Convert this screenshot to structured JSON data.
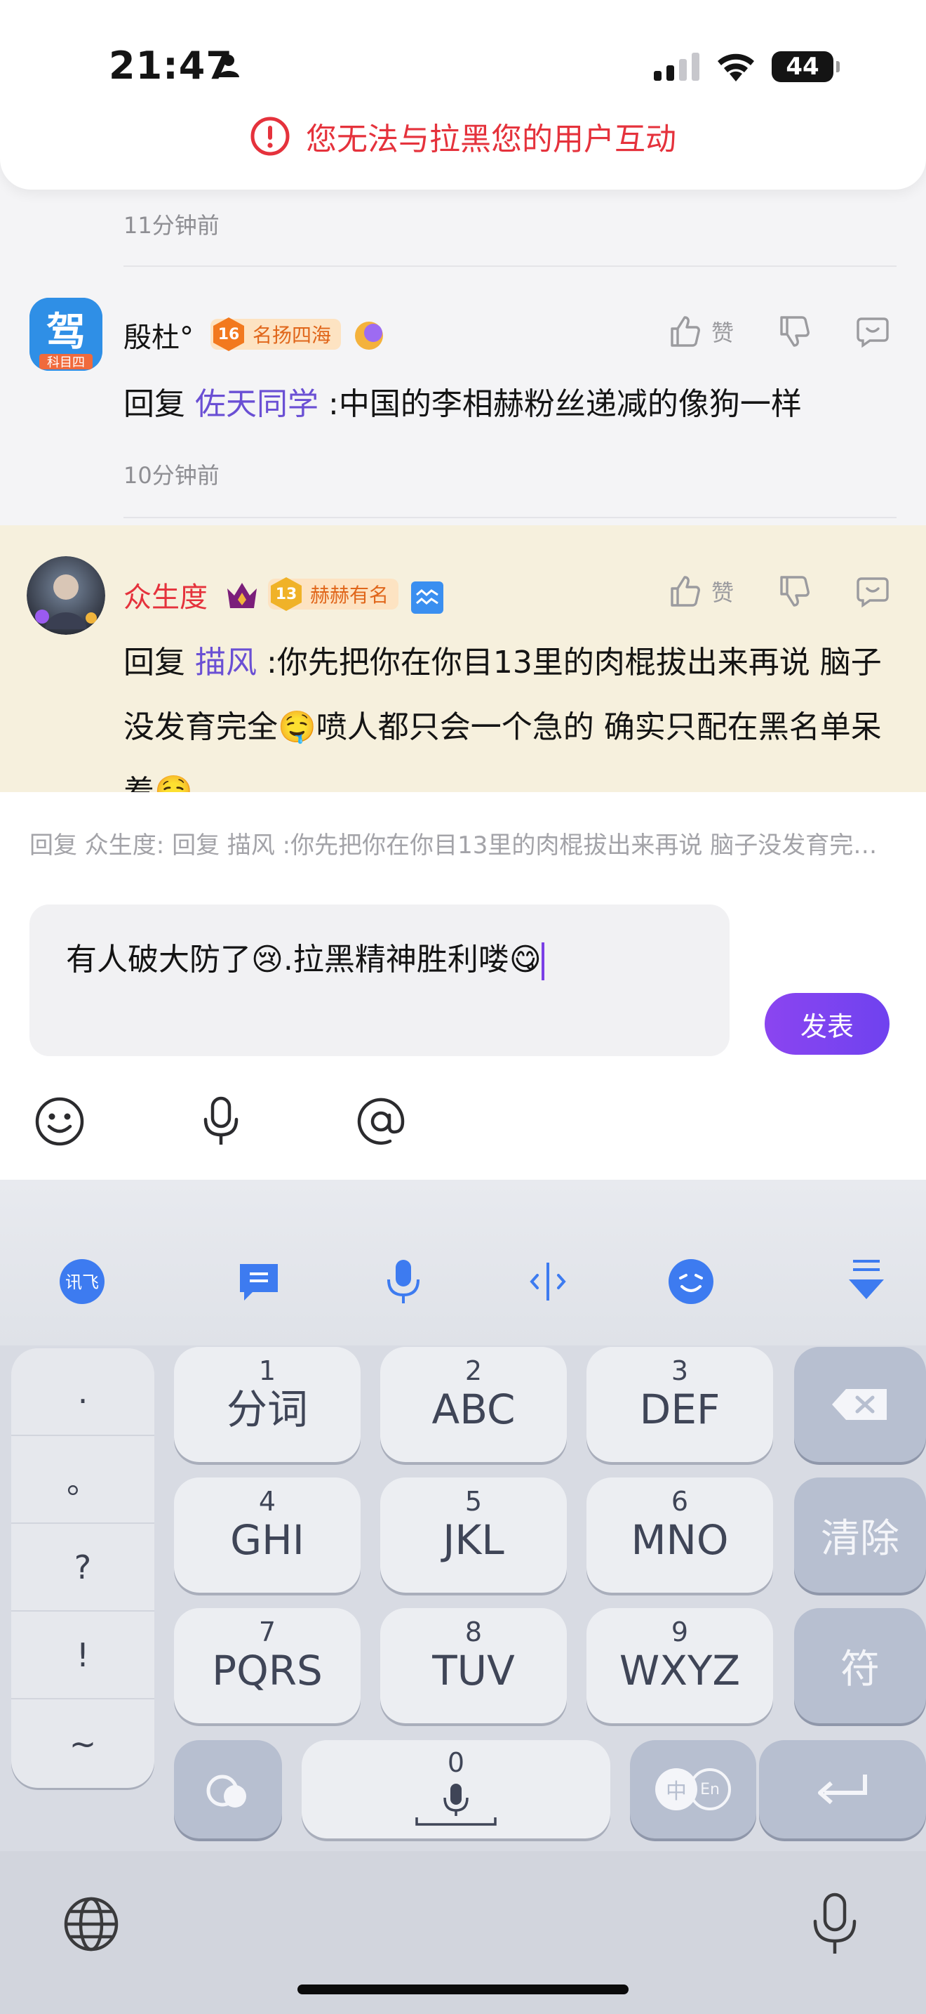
{
  "status_bar": {
    "time": "21:47",
    "battery": "44"
  },
  "banner": {
    "text": "您无法与拉黑您的用户互动"
  },
  "feed": {
    "prev_time": "11分钟前",
    "comments": [
      {
        "username": "殷杜°",
        "badge_level": "16",
        "badge_text": "名扬四海",
        "reply_prefix": "回复",
        "mention": "佐天同学",
        "text": ":中国的李相赫粉丝递减的像狗一样",
        "time": "10分钟前",
        "like_label": "赞",
        "avatar_text": "科目四",
        "name_color": "#141414"
      },
      {
        "username": "众生度",
        "badge_level": "13",
        "badge_text": "赫赫有名",
        "reply_prefix": "回复",
        "mention": "描风",
        "text": ":你先把你在你目13里的肉棍拔出来再说 脑子没发育完全🤤喷人都只会一个急的 确实只配在黑名单呆着🤤",
        "like_label": "赞",
        "name_color": "#e5323c"
      }
    ]
  },
  "composer": {
    "reply_to": "回复 众生度: 回复 描风 :你先把你在你目13里的肉棍拔出来再说 脑子没发育完全🤤喷人都只会一个急的",
    "input_value": "有人破大防了😢.拉黑精神胜利喽😋",
    "post_label": "发表"
  },
  "keyboard": {
    "symbols": [
      ".",
      "。",
      "?",
      "!",
      "~"
    ],
    "keys": [
      {
        "num": "1",
        "label": "分词"
      },
      {
        "num": "2",
        "label": "ABC"
      },
      {
        "num": "3",
        "label": "DEF"
      },
      {
        "num": "4",
        "label": "GHI"
      },
      {
        "num": "5",
        "label": "JKL"
      },
      {
        "num": "6",
        "label": "MNO"
      },
      {
        "num": "7",
        "label": "PQRS"
      },
      {
        "num": "8",
        "label": "TUV"
      },
      {
        "num": "9",
        "label": "WXYZ"
      }
    ],
    "clear_label": "清除",
    "symbol_label": "符",
    "space_num": "0",
    "lang_cn": "中",
    "lang_en": "En"
  },
  "colors": {
    "accent": "#7a44f0",
    "alert": "#e5323c",
    "mention": "#6a4fd4"
  }
}
